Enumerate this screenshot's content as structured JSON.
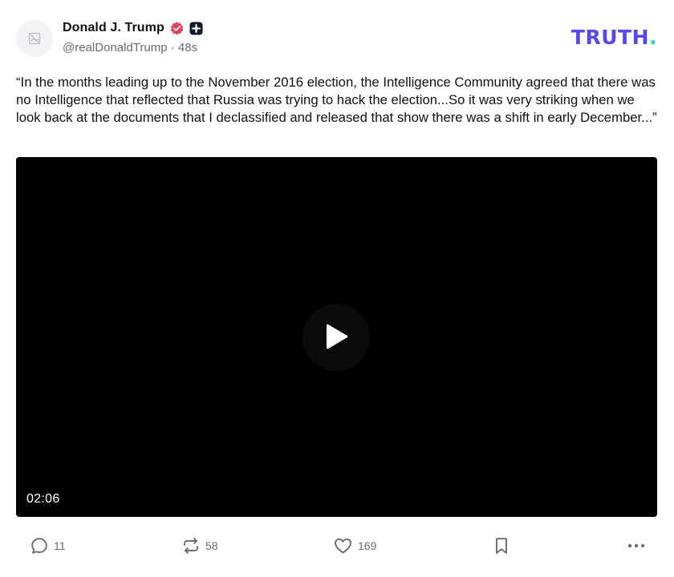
{
  "author": {
    "display_name": "Donald J. Trump",
    "handle": "@realDonaldTrump",
    "separator": "·",
    "time_ago": "48s",
    "verified_icon": "verified-badge-icon",
    "plus_icon": "plus-badge-icon"
  },
  "brand": {
    "logo_text": "TRUTH",
    "logo_dot": ".",
    "logo_color": "#5448ee",
    "logo_dot_color": "#1ecdd8"
  },
  "post": {
    "text": "“In the months leading up to the November 2016 election, the Intelligence Community agreed that there was no Intelligence that reflected that Russia was trying to hack the election...So it was very striking when we look back at the documents that I declassified and released that show there was a shift in early December...”"
  },
  "video": {
    "duration": "02:06",
    "play_icon": "play-icon"
  },
  "actions": {
    "reply": {
      "icon": "reply-icon",
      "count": "11"
    },
    "retruth": {
      "icon": "retruth-icon",
      "count": "58"
    },
    "like": {
      "icon": "heart-icon",
      "count": "169"
    },
    "bookmark": {
      "icon": "bookmark-icon"
    },
    "more": {
      "icon": "more-icon"
    }
  },
  "colors": {
    "verified": "#e0425f",
    "text_muted": "#6a6a75"
  }
}
